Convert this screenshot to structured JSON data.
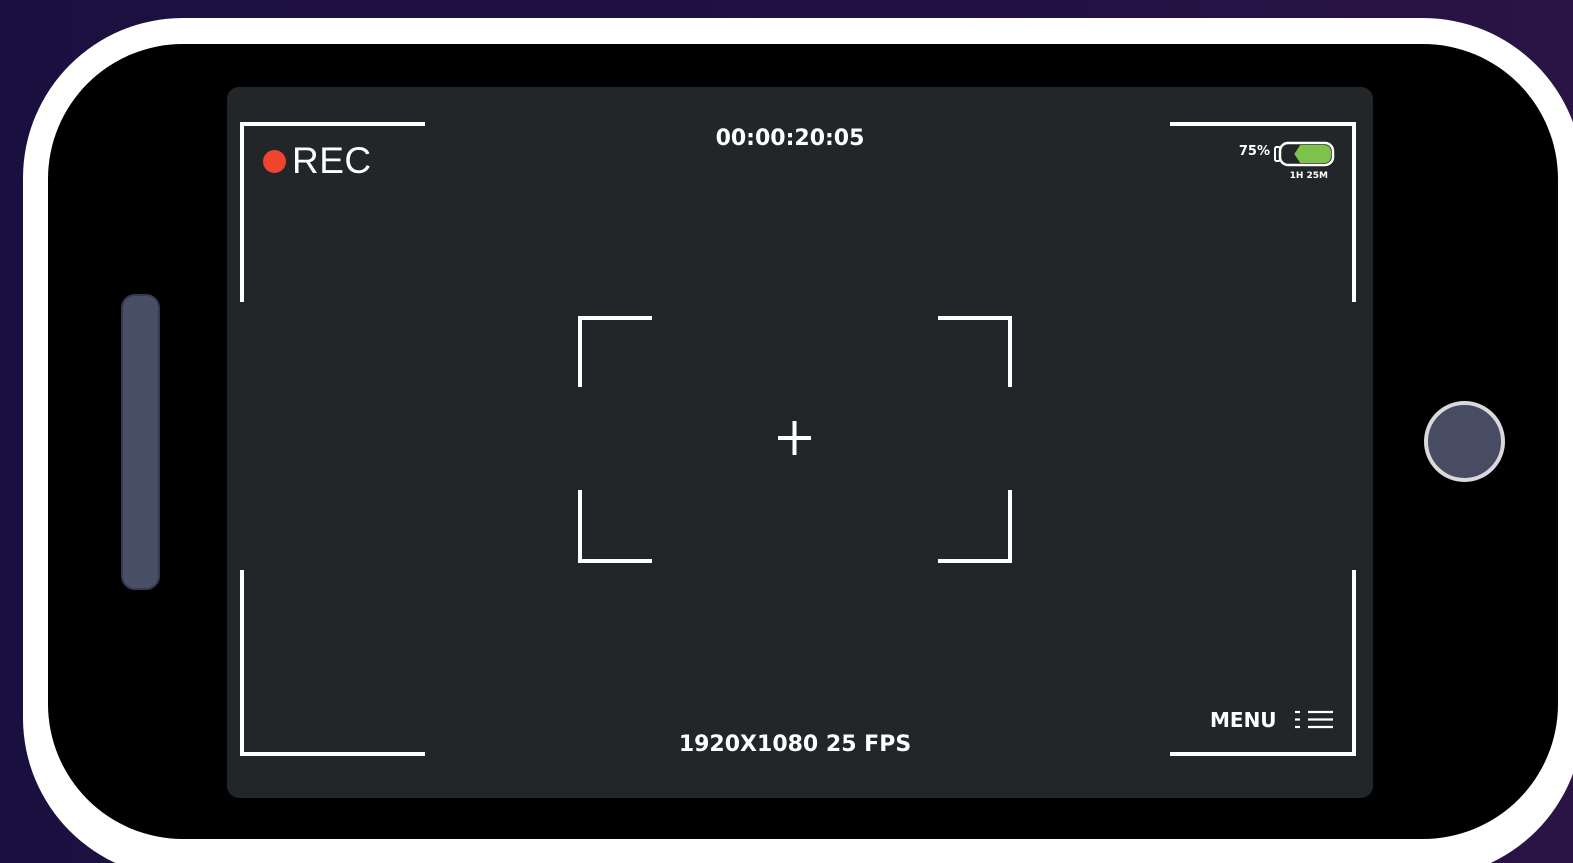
{
  "viewfinder": {
    "recording_label": "REC",
    "timecode": "00:00:20:05",
    "resolution_fps": "1920X1080 25 FPS",
    "menu_label": "MENU"
  },
  "battery": {
    "percent_text": "75%",
    "remaining_text": "1H 25M",
    "level": 0.75,
    "fill_color": "#7dc24b"
  },
  "colors": {
    "rec_dot": "#f0442d",
    "screen": "#222628",
    "frame": "#ffffff",
    "bezel": "#000000",
    "background": "#1f1041",
    "hardware_button": "#474c63"
  },
  "icons": {
    "recording": "red-dot-icon",
    "battery": "battery-icon",
    "menu": "hamburger-list-icon",
    "focus_center": "crosshair-icon"
  }
}
